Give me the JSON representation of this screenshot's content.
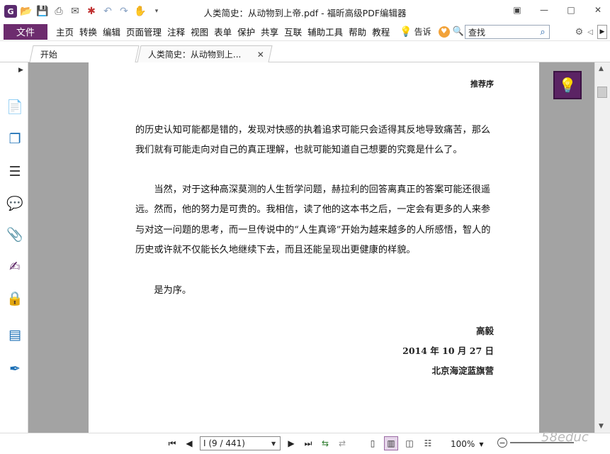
{
  "window": {
    "title": "人类简史：从动物到上帝.pdf - 福昕高级PDF编辑器"
  },
  "menubar": {
    "file_label": "文件",
    "items": [
      "主页",
      "转换",
      "编辑",
      "页面管理",
      "注释",
      "视图",
      "表单",
      "保护",
      "共享",
      "互联",
      "辅助工具",
      "帮助",
      "教程"
    ],
    "tellme_label": "告诉",
    "search_placeholder": "查找"
  },
  "tabs": [
    {
      "label": "开始"
    },
    {
      "label": "人类简史：从动物到上..."
    }
  ],
  "page": {
    "header": "推荐序",
    "paragraphs": [
      "的历史认知可能都是错的，发现对快感的执着追求可能只会适得其反地导致痛苦，那么我们就有可能走向对自己的真正理解，也就可能知道自己想要的究竟是什么了。",
      "　　当然，对于这种高深莫测的人生哲学问题，赫拉利的回答离真正的答案可能还很遥远。然而，他的努力是可贵的。我相信，读了他的这本书之后，一定会有更多的人来参与对这一问题的思考，而一旦传说中的“人生真谛”开始为越来越多的人所感悟，智人的历史或许就不仅能长久地继续下去，而且还能呈现出更健康的样貌。",
      "　　是为序。"
    ],
    "signature": {
      "author": "高毅",
      "date": "2014 年 10 月 27 日",
      "place": "北京海淀蓝旗营"
    }
  },
  "statusbar": {
    "page_indicator": "I (9 / 441)",
    "zoom": "100%"
  },
  "watermark": "58educ"
}
